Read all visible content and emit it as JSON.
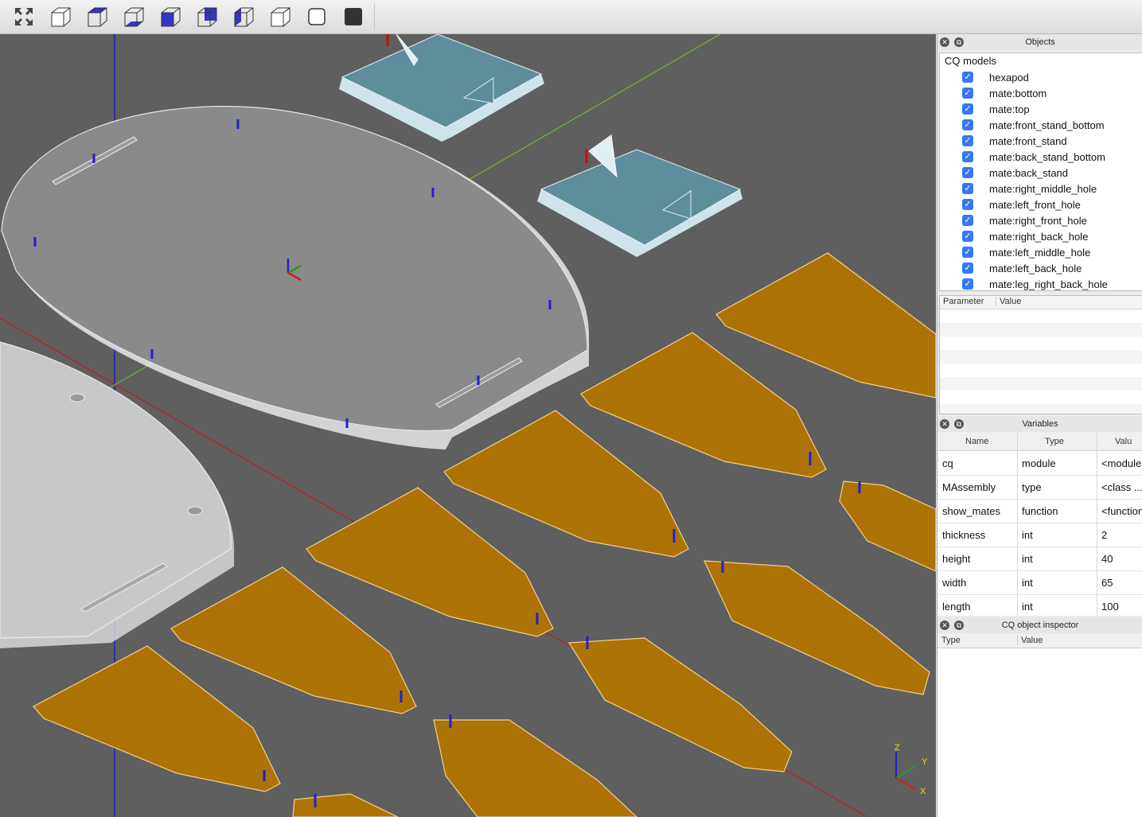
{
  "toolbar": {
    "buttons": [
      {
        "name": "fit-view-icon"
      },
      {
        "name": "view-iso-icon"
      },
      {
        "name": "view-top-icon"
      },
      {
        "name": "view-bottom-icon"
      },
      {
        "name": "view-front-icon"
      },
      {
        "name": "view-back-icon"
      },
      {
        "name": "view-left-icon"
      },
      {
        "name": "view-right-icon"
      },
      {
        "name": "wireframe-mode-icon"
      },
      {
        "name": "shaded-mode-icon"
      }
    ]
  },
  "axes_triad": {
    "z": "Z",
    "y": "Y",
    "x": "X"
  },
  "objects_panel": {
    "title": "Objects",
    "root": "CQ models",
    "items": [
      "hexapod",
      "mate:bottom",
      "mate:top",
      "mate:front_stand_bottom",
      "mate:front_stand",
      "mate:back_stand_bottom",
      "mate:back_stand",
      "mate:right_middle_hole",
      "mate:left_front_hole",
      "mate:right_front_hole",
      "mate:right_back_hole",
      "mate:left_middle_hole",
      "mate:left_back_hole",
      "mate:leg_right_back_hole"
    ],
    "param_headers": {
      "parameter": "Parameter",
      "value": "Value"
    }
  },
  "variables_panel": {
    "title": "Variables",
    "headers": {
      "name": "Name",
      "type": "Type",
      "value": "Valu"
    },
    "rows": [
      {
        "name": "cq",
        "type": "module",
        "value": "<module"
      },
      {
        "name": "MAssembly",
        "type": "type",
        "value": "<class ..."
      },
      {
        "name": "show_mates",
        "type": "function",
        "value": "<function"
      },
      {
        "name": "thickness",
        "type": "int",
        "value": "2"
      },
      {
        "name": "height",
        "type": "int",
        "value": "40"
      },
      {
        "name": "width",
        "type": "int",
        "value": "65"
      },
      {
        "name": "length",
        "type": "int",
        "value": "100"
      }
    ]
  },
  "inspector_panel": {
    "title": "CQ object inspector",
    "headers": {
      "type": "Type",
      "value": "Value"
    }
  },
  "colors": {
    "viewport_bg": "#5f5f5f",
    "plate_light": "#c8c8c8",
    "plate_dark": "#8a8a8a",
    "stand_blue": "#5e8d9c",
    "leg_orange": "#ad7306",
    "checkbox_blue": "#3479f6"
  }
}
